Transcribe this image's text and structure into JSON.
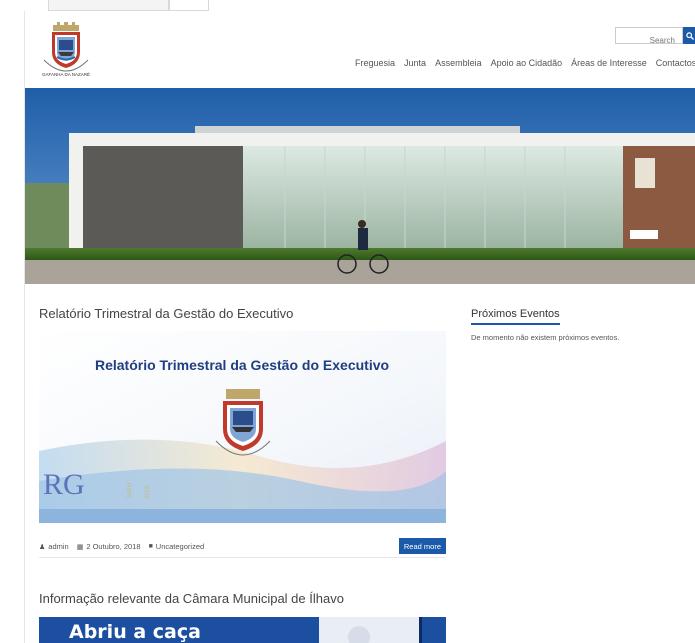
{
  "header": {
    "search_placeholder": "Search",
    "logo_caption": "GAFANHA DA NAZARÉ",
    "nav": [
      "Freguesia",
      "Junta",
      "Assembleia",
      "Apoio ao Cidadão",
      "Áreas de Interesse",
      "Contactos"
    ]
  },
  "posts": [
    {
      "title": "Relatório Trimestral da Gestão do Executivo",
      "image_heading": "Relatório Trimestral da Gestão do Executivo",
      "image_monogram": "RG",
      "image_vertical": [
        "Junho",
        "2018"
      ],
      "author": "admin",
      "date": "2 Outubro, 2018",
      "category": "Uncategorized",
      "read_more": "Read more"
    },
    {
      "title": "Informação relevante da Câmara Municipal de Ílhavo",
      "image_heading": "Abriu a caça"
    }
  ],
  "sidebar": {
    "widget_title": "Próximos Eventos",
    "widget_text": "De momento não existem próximos eventos."
  },
  "colors": {
    "accent": "#1a5aa8",
    "text": "#444444"
  }
}
